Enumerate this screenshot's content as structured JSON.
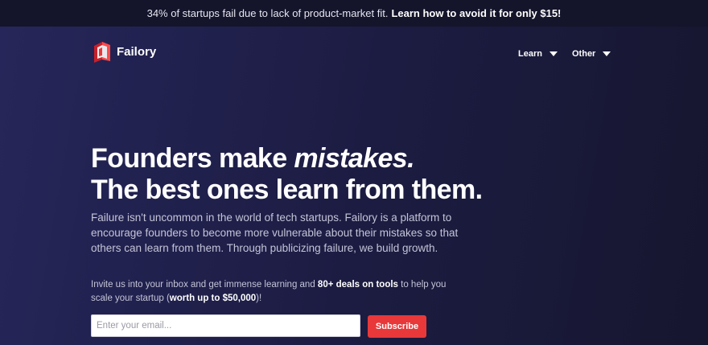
{
  "announcement": {
    "text": "34% of startups fail due to lack of product-market fit.",
    "link": "Learn how to avoid it for only $15!"
  },
  "brand": {
    "name": "Failory",
    "icon": "failory-logo-icon",
    "accent": "#e8383a"
  },
  "nav": {
    "items": [
      {
        "label": "Learn",
        "icon": "caret-down-icon"
      },
      {
        "label": "Other",
        "icon": "caret-down-icon"
      }
    ]
  },
  "hero": {
    "headline_line1_start": "Founders make ",
    "headline_line1_emph": "mistakes.",
    "headline_line2": "The best ones learn from them.",
    "description": "Failure isn't uncommon in the world of tech startups. Failory is a platform to encourage founders to become more vulnerable about their mistakes so that others can learn from them. Through publicizing failure, we build growth.",
    "invite_part1": "Invite us into your inbox and get immense learning and ",
    "invite_bold1": "80+ deals on tools",
    "invite_part2": " to help you scale your startup (",
    "invite_bold2": "worth up to $50,000",
    "invite_part3": ")!"
  },
  "signup": {
    "email_placeholder": "Enter your email...",
    "email_value": "",
    "button_label": "Subscribe"
  },
  "colors": {
    "topbar_bg": "#14142b",
    "hero_bg": "#1d1d45",
    "button_bg": "#e8383a"
  }
}
